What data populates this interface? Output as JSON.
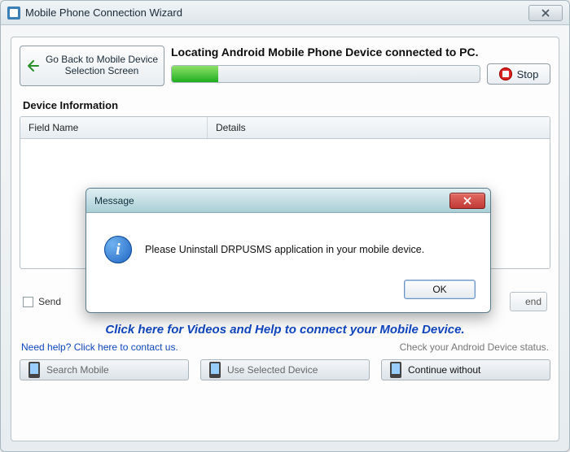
{
  "window": {
    "title": "Mobile Phone Connection Wizard"
  },
  "back_button": "Go Back to Mobile Device Selection Screen",
  "status": "Locating Android Mobile Phone Device connected to PC.",
  "stop_label": "Stop",
  "progress_percent": 15,
  "section_label": "Device Information",
  "table": {
    "col1": "Field Name",
    "col2": "Details"
  },
  "send_row": {
    "label": "Send",
    "tail": "end"
  },
  "help_link": "Click here for Videos and Help to connect your Mobile Device.",
  "contact_link": "Need help? Click here to contact us.",
  "check_status": "Check your Android Device status.",
  "buttons": {
    "search": "Search Mobile",
    "use": "Use Selected Device",
    "cont": "Continue without"
  },
  "modal": {
    "title": "Message",
    "text": "Please Uninstall DRPUSMS application in your mobile device.",
    "ok": "OK"
  }
}
